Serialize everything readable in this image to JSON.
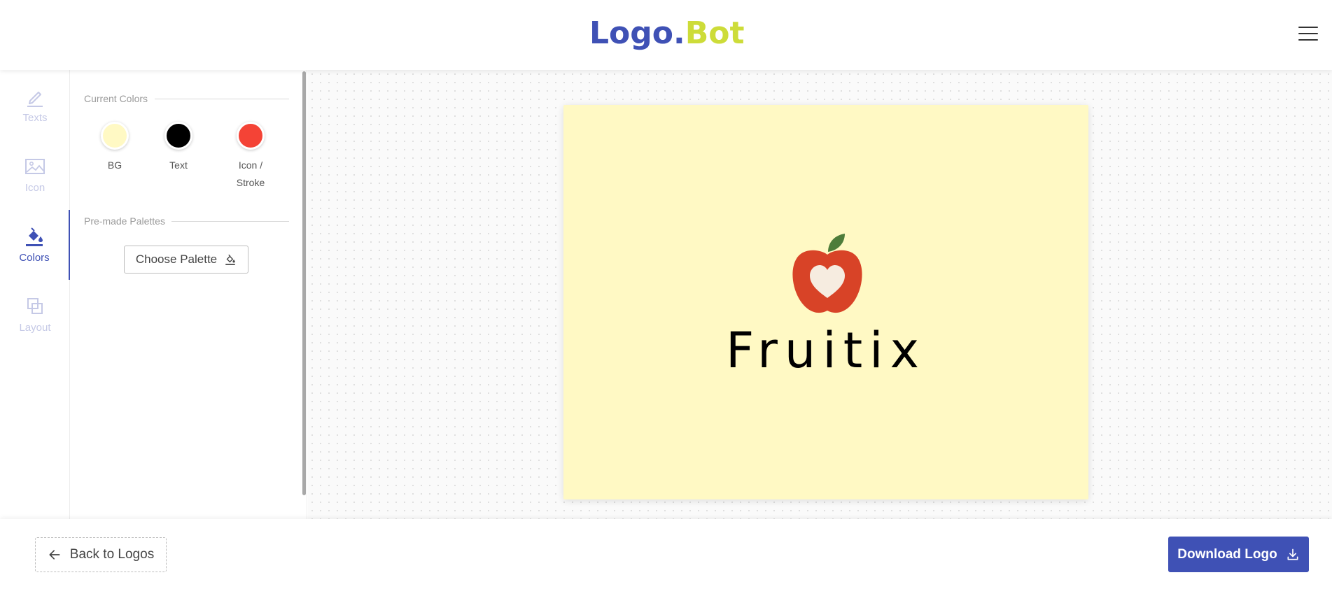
{
  "header": {
    "brand_part1": "Logo.",
    "brand_part2": "Bot",
    "brand_colors": {
      "primary": "#3f51b5",
      "accent": "#cddc39"
    },
    "menu_icon": "hamburger-menu-icon"
  },
  "sidenav": {
    "items": [
      {
        "label": "Texts",
        "icon": "pencil-icon",
        "active": false
      },
      {
        "label": "Icon",
        "icon": "image-icon",
        "active": false
      },
      {
        "label": "Colors",
        "icon": "paint-bucket-icon",
        "active": true
      },
      {
        "label": "Layout",
        "icon": "layers-icon",
        "active": false
      }
    ]
  },
  "panel": {
    "current_colors_title": "Current Colors",
    "swatches": [
      {
        "label": "BG",
        "color": "#fff9c4"
      },
      {
        "label": "Text",
        "color": "#000000"
      },
      {
        "label_line1": "Icon /",
        "label_line2": "Stroke",
        "color": "#f44336"
      }
    ],
    "palettes_title": "Pre-made Palettes",
    "choose_palette_label": "Choose Palette"
  },
  "canvas": {
    "logo_text": "Fruitix",
    "background_color": "#fff9c4",
    "text_color": "#000000",
    "icon": "apple-heart-icon",
    "icon_color": "#d84327"
  },
  "footer": {
    "back_label": "Back to Logos",
    "download_label": "Download Logo"
  }
}
